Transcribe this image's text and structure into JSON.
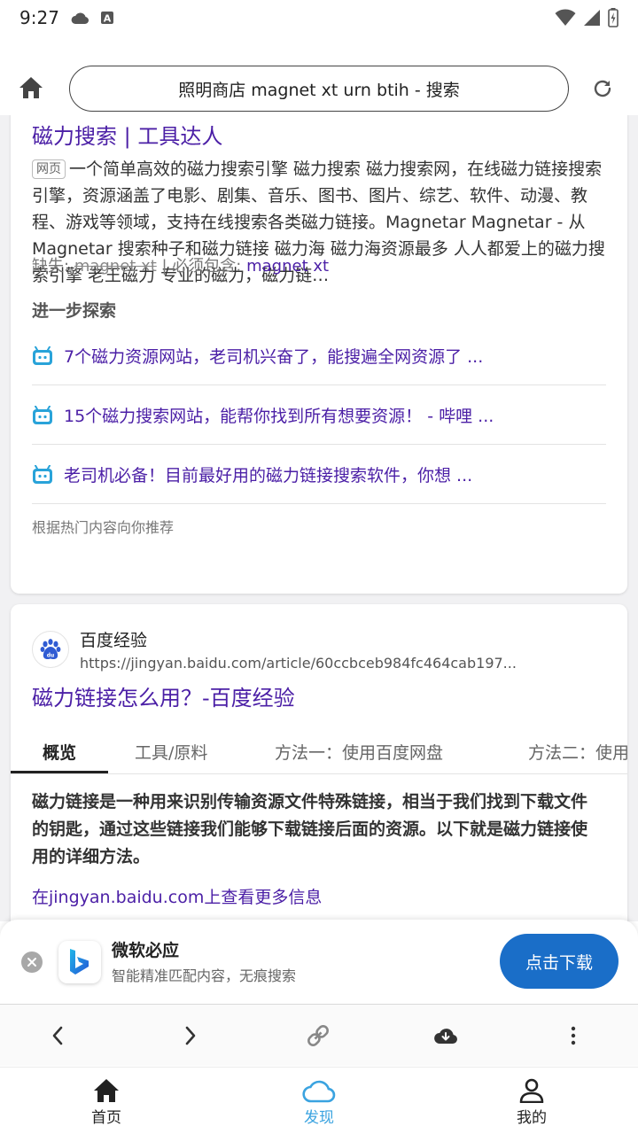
{
  "status_bar": {
    "time": "9:27"
  },
  "address_bar": {
    "url_text": "照明商店 magnet xt urn btih - 搜索"
  },
  "result1": {
    "title": "磁力搜索 | 工具达人",
    "tag": "网页",
    "snippet": "一个简单高效的磁力搜索引擎 磁力搜索 磁力搜索网，在线磁力链接搜索引擎，资源涵盖了电影、剧集、音乐、图书、图片、综艺、软件、动漫、教程、游戏等领域，支持在线搜索各类磁力链接。Magnetar Magnetar - 从 Magnetar 搜索种子和磁力链接 磁力海 磁力海资源最多 人人都爱上的磁力搜索引擎 老王磁力 专业的磁力，磁力链…",
    "missing_label": "缺失:",
    "missing_term": "magnet xt",
    "must_include_label": "| 必须包含:",
    "must_include_term": "magnet xt",
    "explore_heading": "进一步探索",
    "explore_items": [
      {
        "text": "7个磁力资源网站，老司机兴奋了，能搜遍全网资源了 ..."
      },
      {
        "text": "15个磁力搜索网站，能帮你找到所有想要资源！ - 哔哩 ..."
      },
      {
        "text": "老司机必备！目前最好用的磁力链接搜索软件，你想 ..."
      }
    ],
    "recommend_note": "根据热门内容向你推荐"
  },
  "result2": {
    "source_name": "百度经验",
    "source_url": "https://jingyan.baidu.com/article/60ccbceb984fc464cab197...",
    "title": "磁力链接怎么用？-百度经验",
    "tabs": [
      "概览",
      "工具/原料",
      "方法一：使用百度网盘",
      "方法二：使用"
    ],
    "active_tab": 0,
    "summary": "磁力链接是一种用来识别传输资源文件特殊链接，相当于我们找到下载文件的钥匙，通过这些链接我们能够下载链接后面的资源。以下就是磁力链接使用的详细方法。",
    "more_link": "在jingyan.baidu.com上查看更多信息"
  },
  "banner": {
    "app_name": "微软必应",
    "subtitle": "智能精准匹配内容，无痕搜索",
    "button_label": "点击下载"
  },
  "bottom_nav": {
    "items": [
      {
        "label": "首页",
        "icon": "home-icon"
      },
      {
        "label": "发现",
        "icon": "cloud-icon"
      },
      {
        "label": "我的",
        "icon": "person-icon"
      }
    ],
    "active": 1
  },
  "colors": {
    "link": "#4b1fa6",
    "accent_blue": "#1a6ec8",
    "discover_active": "#3aa3e0",
    "bot_icon": "#29a3d9"
  }
}
